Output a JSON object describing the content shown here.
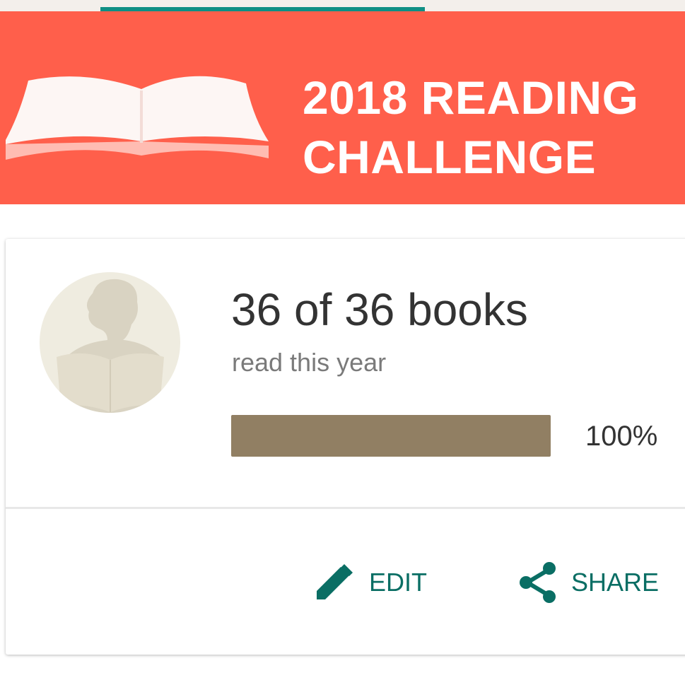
{
  "header": {
    "title": "2018 READING\nCHALLENGE",
    "book_icon": "open-book-icon",
    "colors": {
      "banner": "#ff5f4b",
      "tab_indicator": "#0f8f84"
    }
  },
  "challenge": {
    "avatar_icon": "reader-silhouette-icon",
    "count_text": "36 of 36 books",
    "subtitle": "read this year",
    "progress": {
      "percent_label": "100%",
      "fraction": 1.0,
      "fill_color": "#917f63"
    }
  },
  "actions": {
    "edit": {
      "label": "EDIT",
      "icon": "pencil-icon"
    },
    "share": {
      "label": "SHARE",
      "icon": "share-icon"
    },
    "color": "#0a6e64"
  }
}
